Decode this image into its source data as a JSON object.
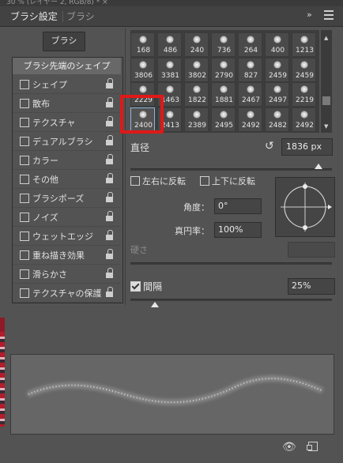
{
  "document_tab": "30 % (レイヤー 2, RGB/8) * ×",
  "panel": {
    "tabs": [
      "ブラシ設定",
      "ブラシ"
    ],
    "collapse_glyph": "»",
    "brush_button": "ブラシ",
    "brush_tip_shape": "ブラシ先端のシェイプ",
    "options": [
      {
        "label": "シェイプ",
        "checked": false
      },
      {
        "label": "散布",
        "checked": false
      },
      {
        "label": "テクスチャ",
        "checked": false
      },
      {
        "label": "デュアルブラシ",
        "checked": false
      },
      {
        "label": "カラー",
        "checked": false
      },
      {
        "label": "その他",
        "checked": false
      },
      {
        "label": "ブラシポーズ",
        "checked": false
      },
      {
        "label": "ノイズ",
        "checked": false
      },
      {
        "label": "ウェットエッジ",
        "checked": false
      },
      {
        "label": "重ね描き効果",
        "checked": false
      },
      {
        "label": "滑らかさ",
        "checked": false
      },
      {
        "label": "テクスチャの保護",
        "checked": false
      }
    ]
  },
  "brush_grid": {
    "rows": [
      [
        "168",
        "486",
        "240",
        "736",
        "264",
        "400",
        "1213"
      ],
      [
        "3806",
        "3381",
        "3802",
        "2790",
        "827",
        "2459",
        "2459"
      ],
      [
        "2229",
        "1463",
        "1822",
        "1881",
        "2467",
        "2497",
        "2219"
      ],
      [
        "2400",
        "2413",
        "2389",
        "2495",
        "2492",
        "2482",
        "2492"
      ]
    ],
    "selected": "2400",
    "scroll_up": "▲",
    "scroll_down": "▼"
  },
  "size": {
    "label": "直径",
    "value": "1836 px",
    "reset_icon": "↺"
  },
  "flip": {
    "x_label": "左右に反転",
    "y_label": "上下に反転"
  },
  "angle": {
    "label": "角度：",
    "value": "0°"
  },
  "roundness": {
    "label": "真円率：",
    "value": "100%"
  },
  "hardness": {
    "label": "硬さ"
  },
  "spacing": {
    "label": "間隔",
    "value": "25%",
    "checked": true
  },
  "footer": {
    "eye_icon": "👁"
  }
}
